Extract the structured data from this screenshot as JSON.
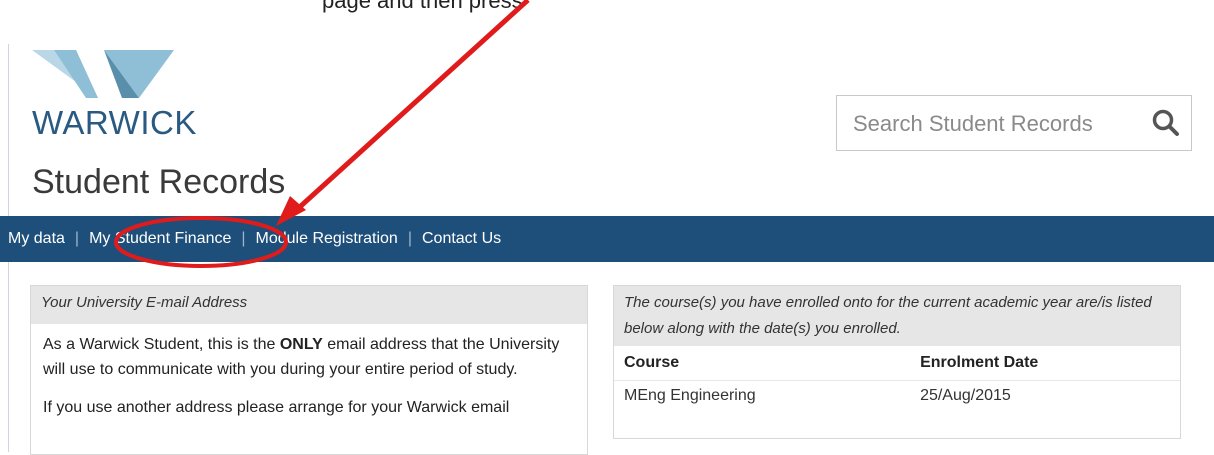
{
  "instruction_fragment": "page and then press",
  "logo": {
    "text": "WARWICK"
  },
  "search": {
    "placeholder": "Search Student Records"
  },
  "page_title": "Student Records",
  "nav": {
    "items": [
      {
        "label": "My data"
      },
      {
        "label": "My Student Finance"
      },
      {
        "label": "Module Registration"
      },
      {
        "label": "Contact Us"
      }
    ]
  },
  "email_panel": {
    "heading": "Your University E-mail Address",
    "para1_pre": "As a Warwick Student, this is the ",
    "para1_bold": "ONLY",
    "para1_post": " email address that the University will use to communicate with you during your entire period of study.",
    "para2": "If you use another address please arrange for your Warwick email"
  },
  "course_panel": {
    "heading": "The course(s) you have enrolled onto for the current academic year are/is listed below along with the date(s) you enrolled.",
    "columns": [
      "Course",
      "Enrolment Date"
    ],
    "rows": [
      {
        "course": "MEng Engineering",
        "date": "25/Aug/2015"
      }
    ]
  },
  "colors": {
    "nav_bg": "#1e4f7b",
    "annotation": "#e01b1b",
    "logo_light": "#8fbfd6",
    "logo_dark": "#5a8fab"
  }
}
